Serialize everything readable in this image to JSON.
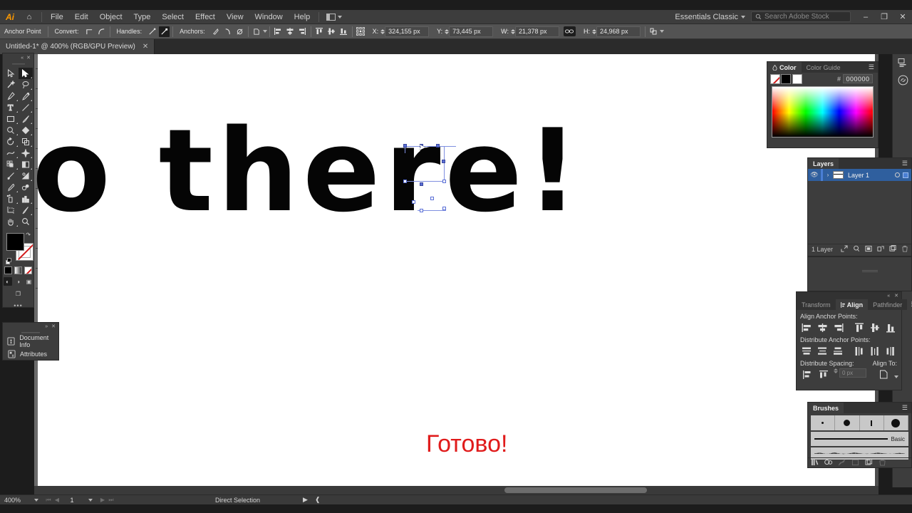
{
  "app": {
    "name": "Adobe Illustrator",
    "logo_text": "Ai",
    "home_icon": "home-icon"
  },
  "menubar": {
    "items": [
      "File",
      "Edit",
      "Object",
      "Type",
      "Select",
      "Effect",
      "View",
      "Window",
      "Help"
    ],
    "arrange_label": "arrange-documents-icon",
    "workspace": "Essentials Classic",
    "search_placeholder": "Search Adobe Stock",
    "window_buttons": {
      "minimize": "–",
      "restore": "❐",
      "close": "✕"
    }
  },
  "controlbar": {
    "context_label": "Anchor Point",
    "convert_label": "Convert:",
    "handles_label": "Handles:",
    "anchors_label": "Anchors:",
    "x_label": "X:",
    "x_value": "324,155 px",
    "y_label": "Y:",
    "y_value": "73,445 px",
    "w_label": "W:",
    "w_value": "21,378 px",
    "h_label": "H:",
    "h_value": "24,968 px",
    "link_icon": "link-proportions-icon"
  },
  "document_tab": {
    "title": "Untitled-1* @ 400% (RGB/GPU Preview)",
    "close": "✕"
  },
  "toolbar": {
    "tools": [
      {
        "name": "selection-tool",
        "glyph": "▷",
        "selected": false
      },
      {
        "name": "direct-selection-tool",
        "glyph": "▶",
        "selected": true
      },
      {
        "name": "magic-wand-tool",
        "glyph": "✨",
        "selected": false
      },
      {
        "name": "lasso-tool",
        "glyph": "➰",
        "selected": false
      },
      {
        "name": "pen-tool",
        "glyph": "✒",
        "selected": false
      },
      {
        "name": "curvature-tool",
        "glyph": "✎",
        "selected": false
      },
      {
        "name": "type-tool",
        "glyph": "T",
        "selected": false
      },
      {
        "name": "line-segment-tool",
        "glyph": "╱",
        "selected": false
      },
      {
        "name": "rectangle-tool",
        "glyph": "▭",
        "selected": false
      },
      {
        "name": "paintbrush-tool",
        "glyph": "✐",
        "selected": false
      },
      {
        "name": "shaper-tool",
        "glyph": "◌",
        "selected": false
      },
      {
        "name": "eraser-tool",
        "glyph": "◆",
        "selected": false
      },
      {
        "name": "rotate-tool",
        "glyph": "↻",
        "selected": false
      },
      {
        "name": "scale-tool",
        "glyph": "⧉",
        "selected": false
      },
      {
        "name": "width-tool",
        "glyph": "≈",
        "selected": false
      },
      {
        "name": "free-transform-tool",
        "glyph": "✶",
        "selected": false
      },
      {
        "name": "shape-builder-tool",
        "glyph": "◔",
        "selected": false
      },
      {
        "name": "perspective-grid-tool",
        "glyph": "◱",
        "selected": false
      },
      {
        "name": "mesh-tool",
        "glyph": "⌗",
        "selected": false
      },
      {
        "name": "gradient-tool",
        "glyph": "◧",
        "selected": false
      },
      {
        "name": "eyedropper-tool",
        "glyph": "⚗",
        "selected": false
      },
      {
        "name": "blend-tool",
        "glyph": "❂",
        "selected": false
      },
      {
        "name": "symbol-sprayer-tool",
        "glyph": "☂",
        "selected": false
      },
      {
        "name": "column-graph-tool",
        "glyph": "█",
        "selected": false
      },
      {
        "name": "artboard-tool",
        "glyph": "⬚",
        "selected": false
      },
      {
        "name": "slice-tool",
        "glyph": "✂",
        "selected": false
      },
      {
        "name": "hand-tool",
        "glyph": "✋",
        "selected": false
      },
      {
        "name": "zoom-tool",
        "glyph": "⌕",
        "selected": false
      }
    ],
    "fill_color": "#000000",
    "stroke_color": "#ffffff",
    "swap_icon": "swap-fill-stroke-icon",
    "default_icon": "default-fill-stroke-icon",
    "mini_swatches": [
      "color-swatch",
      "gradient-swatch",
      "none-swatch"
    ],
    "draw_modes": [
      "draw-normal-icon",
      "draw-behind-icon",
      "draw-inside-icon"
    ],
    "screen_mode": "change-screen-mode-icon",
    "more_tools": "•••"
  },
  "canvas": {
    "artwork_text": "o there!",
    "artwork_color": "#050505",
    "done_text": "Готово!",
    "done_color": "#e01b1b",
    "cursor": "direct-selection-cursor"
  },
  "color_panel": {
    "tabs": [
      {
        "label": "Color",
        "active": true
      },
      {
        "label": "Color Guide",
        "active": false
      }
    ],
    "hex_label": "#",
    "hex_value": "000000",
    "fill_swatch": "none-fill-swatch",
    "black_swatch": "#000000",
    "white_swatch": "#ffffff",
    "menu_icon": "panel-menu-icon"
  },
  "layers_panel": {
    "title": "Layers",
    "layers": [
      {
        "name": "Layer 1",
        "visible": true,
        "selected": true
      }
    ],
    "footer_count": "1 Layer",
    "footer_icons": [
      "locate-object-icon",
      "make-clipping-mask-icon",
      "new-sublayer-icon",
      "release-to-layers-icon",
      "new-layer-icon",
      "delete-layer-icon"
    ]
  },
  "align_panel": {
    "tabs": [
      {
        "label": "Transform",
        "active": false
      },
      {
        "label": "Align",
        "active": true
      },
      {
        "label": "Pathfinder",
        "active": false
      }
    ],
    "section_align": "Align Anchor Points:",
    "section_distribute": "Distribute Anchor Points:",
    "section_spacing": "Distribute Spacing:",
    "section_alignto": "Align To:",
    "spacing_value": "0 px",
    "align_buttons": [
      "align-left-icon",
      "align-horizontal-center-icon",
      "align-right-icon",
      "align-top-icon",
      "align-vertical-center-icon",
      "align-bottom-icon"
    ],
    "distribute_buttons": [
      "distribute-top-icon",
      "distribute-vertical-center-icon",
      "distribute-bottom-icon",
      "distribute-left-icon",
      "distribute-horizontal-center-icon",
      "distribute-right-icon"
    ],
    "spacing_buttons": [
      "vertical-distribute-space-icon",
      "horizontal-distribute-space-icon"
    ],
    "alignto_icon": "align-to-selection-icon",
    "menu_icon": "panel-menu-icon"
  },
  "brushes_panel": {
    "title": "Brushes",
    "brush_label": "Basic",
    "footer_icons": [
      "brush-libraries-icon",
      "libraries-panel-icon",
      "remove-brush-stroke-icon",
      "options-of-selected-object-icon",
      "new-brush-icon",
      "delete-brush-icon"
    ]
  },
  "docinfo_panel": {
    "items": [
      {
        "label": "Document Info",
        "icon": "document-info-icon"
      },
      {
        "label": "Attributes",
        "icon": "attributes-icon"
      }
    ],
    "collapse": "»",
    "close": "✕"
  },
  "right_rail": {
    "icons": [
      "properties-icon",
      "libraries-icon"
    ]
  },
  "statusbar": {
    "zoom": "400%",
    "page": "1",
    "tool_name": "Direct Selection",
    "nav_first": "⏮",
    "nav_prev": "◀",
    "nav_next": "▶",
    "nav_last": "⏭"
  }
}
